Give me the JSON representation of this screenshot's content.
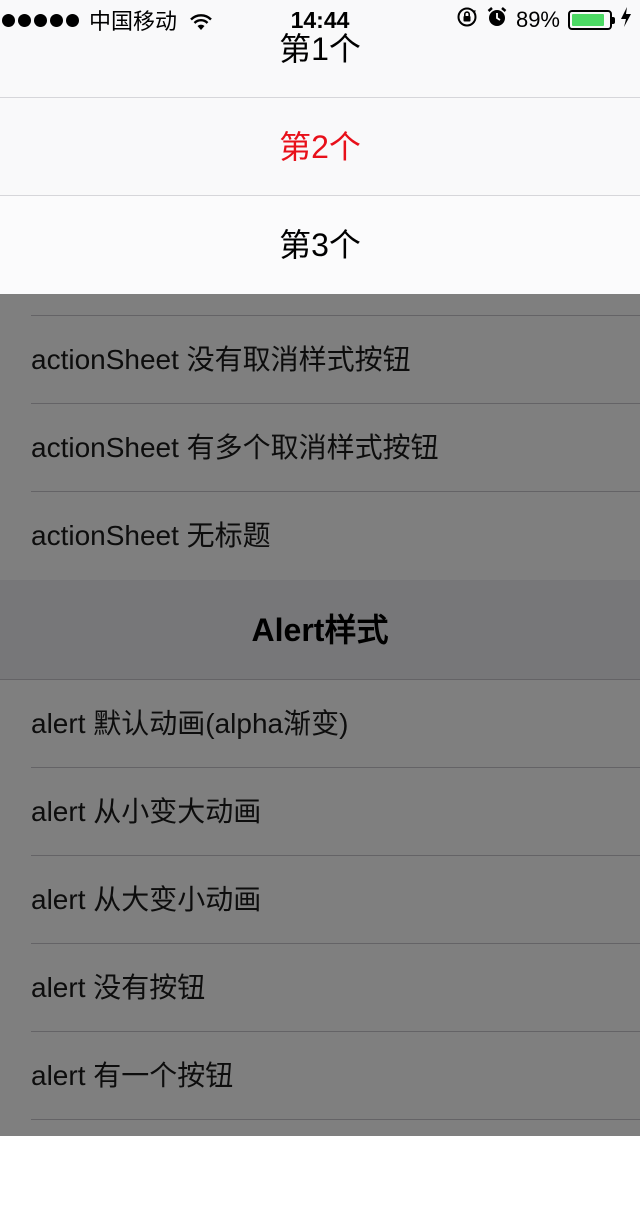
{
  "status_bar": {
    "carrier": "中国移动",
    "time": "14:44",
    "battery_percent": "89%",
    "battery_level": 0.89,
    "battery_color": "#4cd964",
    "icons": [
      "signal-icon",
      "wifi-icon",
      "rotation-lock-icon",
      "alarm-icon",
      "battery-icon",
      "charging-icon"
    ]
  },
  "action_sheet": {
    "items": [
      {
        "label": "第1个",
        "color": "#000000"
      },
      {
        "label": "第2个",
        "color": "#e8101a"
      },
      {
        "label": "第3个",
        "color": "#000000"
      }
    ]
  },
  "table": {
    "rows_top": [
      {
        "label": "actionSheet 没有取消样式按钮"
      },
      {
        "label": "actionSheet 有多个取消样式按钮"
      },
      {
        "label": "actionSheet 无标题"
      }
    ],
    "section_header": "Alert样式",
    "rows_bottom": [
      {
        "label": "alert 默认动画(alpha渐变)"
      },
      {
        "label": "alert 从小变大动画"
      },
      {
        "label": "alert 从大变小动画"
      },
      {
        "label": "alert 没有按钮"
      },
      {
        "label": "alert 有一个按钮"
      }
    ]
  }
}
